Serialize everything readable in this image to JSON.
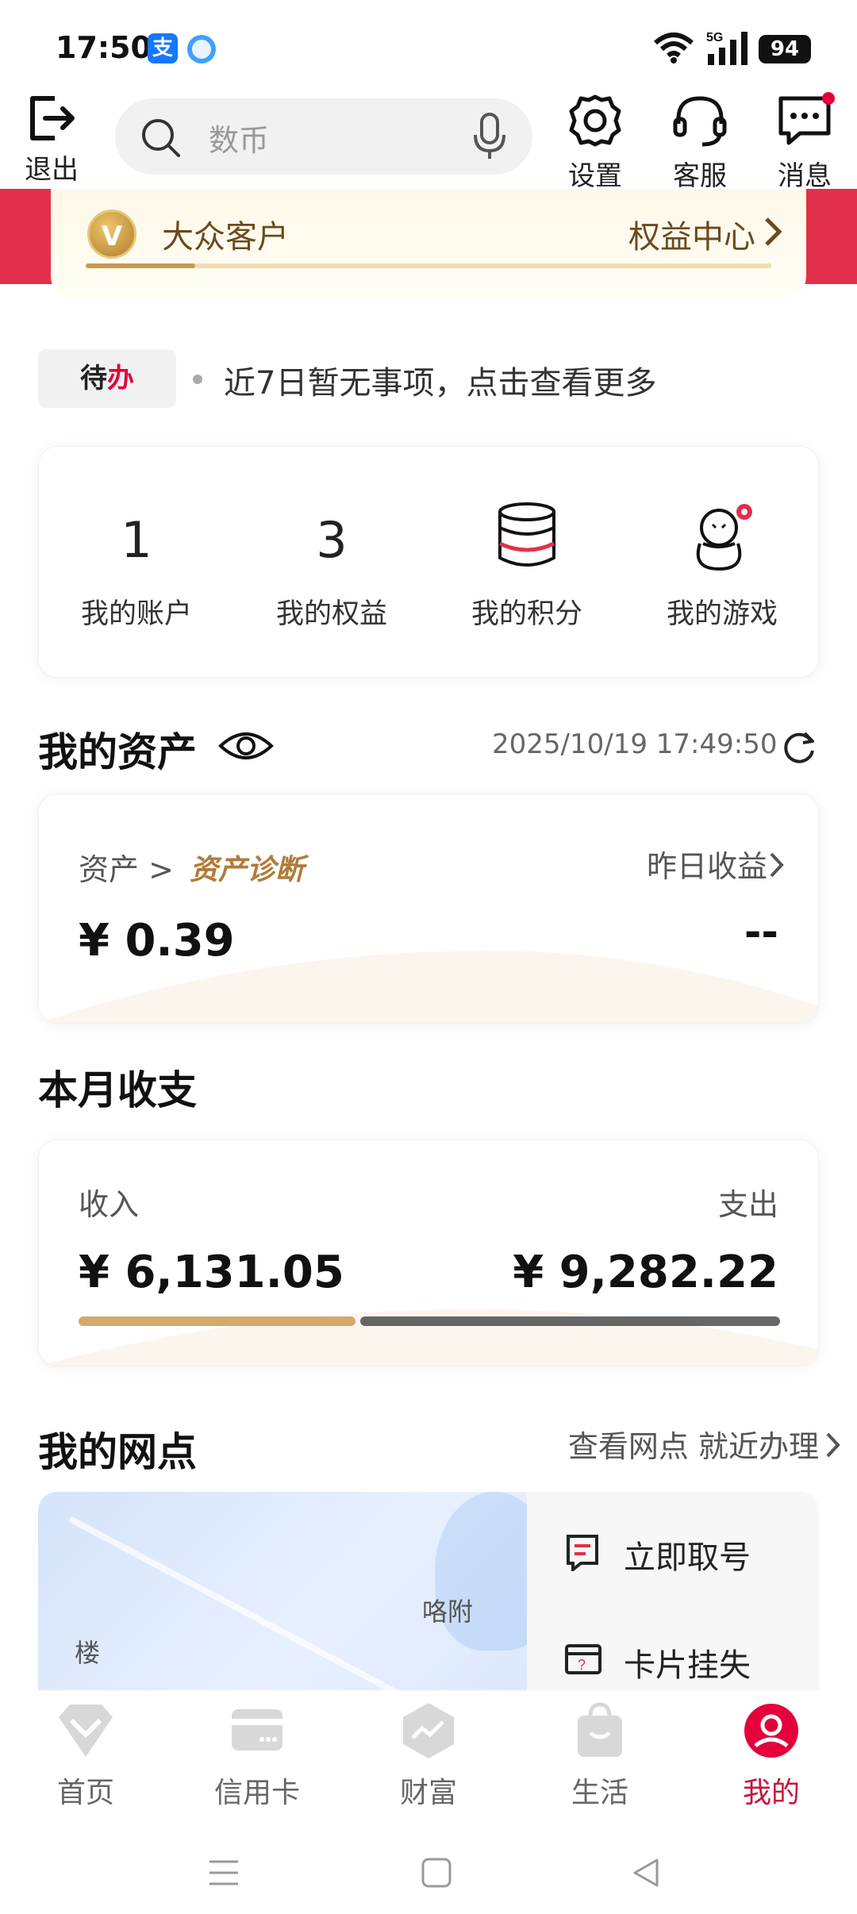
{
  "status_bar": {
    "time": "17:50",
    "network": "5G",
    "battery": "94",
    "alipay_glyph": "支"
  },
  "top_bar": {
    "exit_label": "退出",
    "search_placeholder": "数币",
    "settings_label": "设置",
    "service_label": "客服",
    "messages_label": "消息"
  },
  "member": {
    "level": "大众客户",
    "rights_center": "权益中心",
    "badge": "V",
    "progress": 0.16
  },
  "todo": {
    "tag_part1": "待",
    "tag_part2": "办",
    "message": "近7日暂无事项，点击查看更多"
  },
  "quick_stats": [
    {
      "value": "1",
      "label": "我的账户"
    },
    {
      "value": "3",
      "label": "我的权益"
    },
    {
      "icon": "database-icon",
      "label": "我的积分"
    },
    {
      "icon": "snowman-game-icon",
      "label": "我的游戏"
    }
  ],
  "assets": {
    "title": "我的资产",
    "timestamp": "2025/10/19 17:49:50",
    "asset_label": "资产 >",
    "diagnosis_label": "资产诊断",
    "asset_value": "¥ 0.39",
    "yesterday_label": "昨日收益",
    "yesterday_value": "--"
  },
  "monthly": {
    "title": "本月收支",
    "income_label": "收入",
    "expense_label": "支出",
    "income_value": "¥ 6,131.05",
    "expense_value": "¥ 9,282.22",
    "income_amount": 6131.05,
    "expense_amount": 9282.22,
    "income_color": "#d4a96a",
    "expense_color": "#666666"
  },
  "outlet": {
    "title": "我的网点",
    "links": "查看网点 就近办理",
    "map_label_1": "咯附",
    "map_label_2": "楼",
    "services": [
      {
        "label": "立即取号",
        "icon": "ticket-icon"
      },
      {
        "label": "卡片挂失",
        "icon": "card-lost-icon"
      }
    ]
  },
  "bottom_nav": [
    {
      "label": "首页",
      "icon": "home-diamond-icon",
      "active": false
    },
    {
      "label": "信用卡",
      "icon": "credit-card-icon",
      "active": false
    },
    {
      "label": "财富",
      "icon": "wealth-icon",
      "active": false
    },
    {
      "label": "生活",
      "icon": "shopping-bag-icon",
      "active": false
    },
    {
      "label": "我的",
      "icon": "profile-icon",
      "active": true
    }
  ],
  "colors": {
    "brand_red": "#e2304a",
    "gold": "#c89a4e",
    "active_red": "#c8143c"
  }
}
